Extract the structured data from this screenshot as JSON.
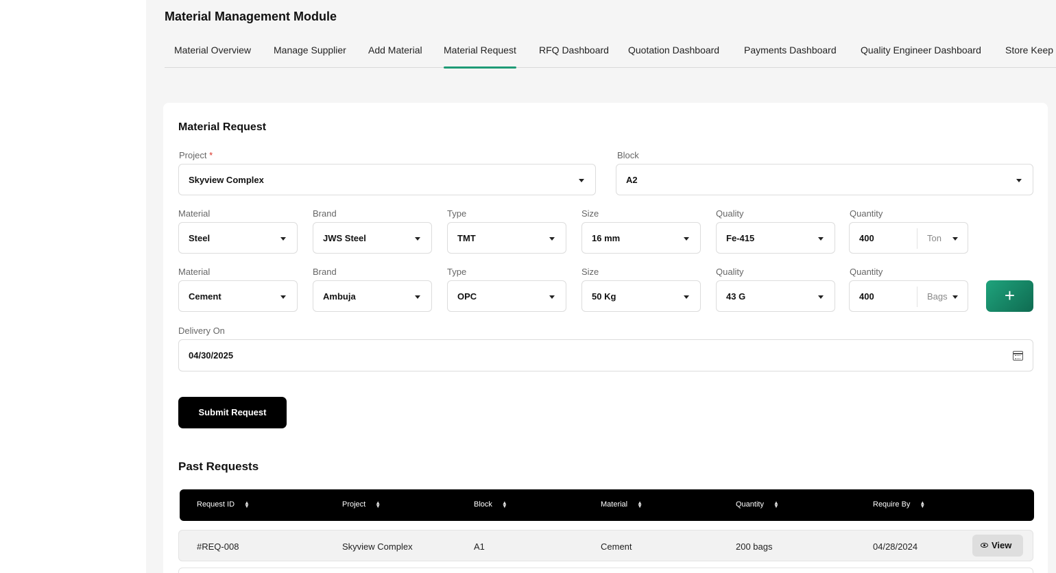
{
  "module_title": "Material Management Module",
  "tabs": [
    {
      "label": "Material Overview",
      "active": false
    },
    {
      "label": "Manage Supplier",
      "active": false
    },
    {
      "label": "Add Material",
      "active": false
    },
    {
      "label": "Material Request",
      "active": true
    },
    {
      "label": "RFQ Dashboard",
      "active": false
    },
    {
      "label": "Quotation Dashboard",
      "active": false
    },
    {
      "label": "Payments Dashboard",
      "active": false
    },
    {
      "label": "Quality Engineer Dashboard",
      "active": false
    },
    {
      "label": "Store Keep",
      "active": false
    }
  ],
  "form": {
    "title": "Material Request",
    "project": {
      "label": "Project",
      "required_mark": "*",
      "value": "Skyview Complex"
    },
    "block": {
      "label": "Block",
      "value": "A2"
    },
    "labels": {
      "material": "Material",
      "brand": "Brand",
      "type": "Type",
      "size": "Size",
      "quality": "Quality",
      "quantity": "Quantity"
    },
    "rows": [
      {
        "material": "Steel",
        "brand": "JWS Steel",
        "type": "TMT",
        "size": "16 mm",
        "quality": "Fe-415",
        "quantity": "400",
        "unit": "Ton"
      },
      {
        "material": "Cement",
        "brand": "Ambuja",
        "type": "OPC",
        "size": "50 Kg",
        "quality": "43 G",
        "quantity": "400",
        "unit": "Bags"
      }
    ],
    "add_button": "+",
    "delivery": {
      "label": "Delivery On",
      "value": "04/30/2025"
    },
    "submit_label": "Submit Request"
  },
  "past_requests": {
    "title": "Past Requests",
    "columns": [
      "Request ID",
      "Project",
      "Block",
      "Material",
      "Quantity",
      "Require By"
    ],
    "rows": [
      {
        "id": "#REQ-008",
        "project": "Skyview Complex",
        "block": "A1",
        "material": "Cement",
        "quantity": "200 bags",
        "require_by": "04/28/2024",
        "action": "View"
      }
    ]
  },
  "icons": {
    "dropdown": "chevron-down-icon",
    "calendar": "calendar-icon",
    "sort": "sort-icon",
    "view": "eye-icon",
    "add": "plus-icon"
  },
  "colors": {
    "accent": "#1e9b76",
    "add_button": "#138a68",
    "header_bg": "#000000",
    "page_bg": "#f5f5f5"
  }
}
